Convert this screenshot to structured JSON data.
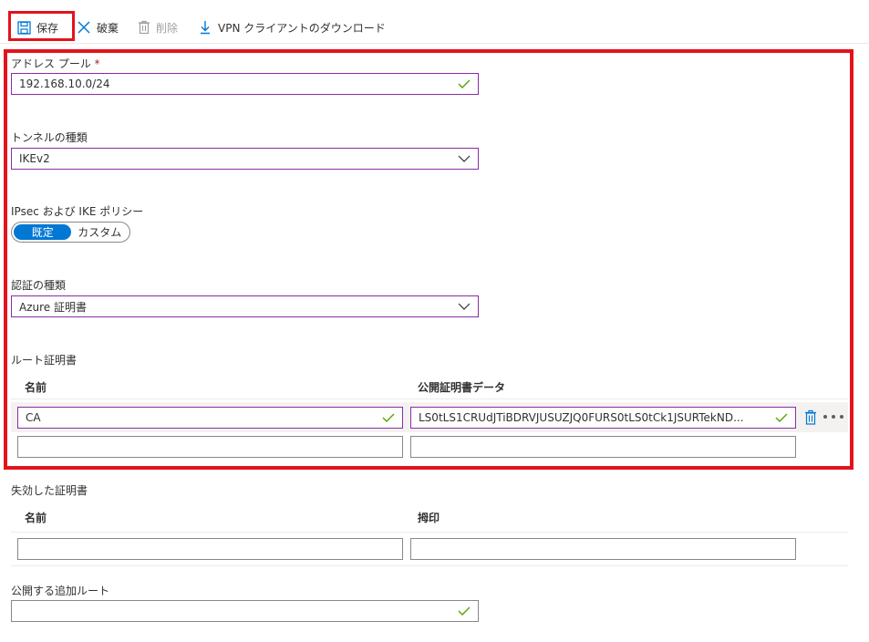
{
  "toolbar": {
    "save_label": "保存",
    "discard_label": "破棄",
    "delete_label": "削除",
    "download_label": "VPN クライアントのダウンロード"
  },
  "form": {
    "address_pool": {
      "label": "アドレス プール",
      "required_mark": "*",
      "value": "192.168.10.0/24"
    },
    "tunnel_type": {
      "label": "トンネルの種類",
      "value": "IKEv2"
    },
    "ipsec_policy": {
      "label": "IPsec および IKE ポリシー",
      "options": [
        "既定",
        "カスタム"
      ],
      "selected": "既定"
    },
    "auth_type": {
      "label": "認証の種類",
      "value": "Azure 証明書"
    },
    "root_certs": {
      "label": "ルート証明書",
      "columns": [
        "名前",
        "公開証明書データ"
      ],
      "rows": [
        {
          "name": "CA",
          "data": "LS0tLS1CRUdJTiBDRVJUSUZJQ0FURS0tLS0tCk1JSURTekND..."
        },
        {
          "name": "",
          "data": ""
        }
      ]
    },
    "revoked_certs": {
      "label": "失効した証明書",
      "columns": [
        "名前",
        "拇印"
      ],
      "rows": [
        {
          "name": "",
          "thumbprint": ""
        }
      ]
    },
    "additional_routes": {
      "label": "公開する追加ルート",
      "value": ""
    }
  },
  "colors": {
    "highlight_frame": "#e3131b",
    "accent": "#0078d4",
    "valid_check": "#57a300",
    "focused_border": "#8a2da5"
  }
}
